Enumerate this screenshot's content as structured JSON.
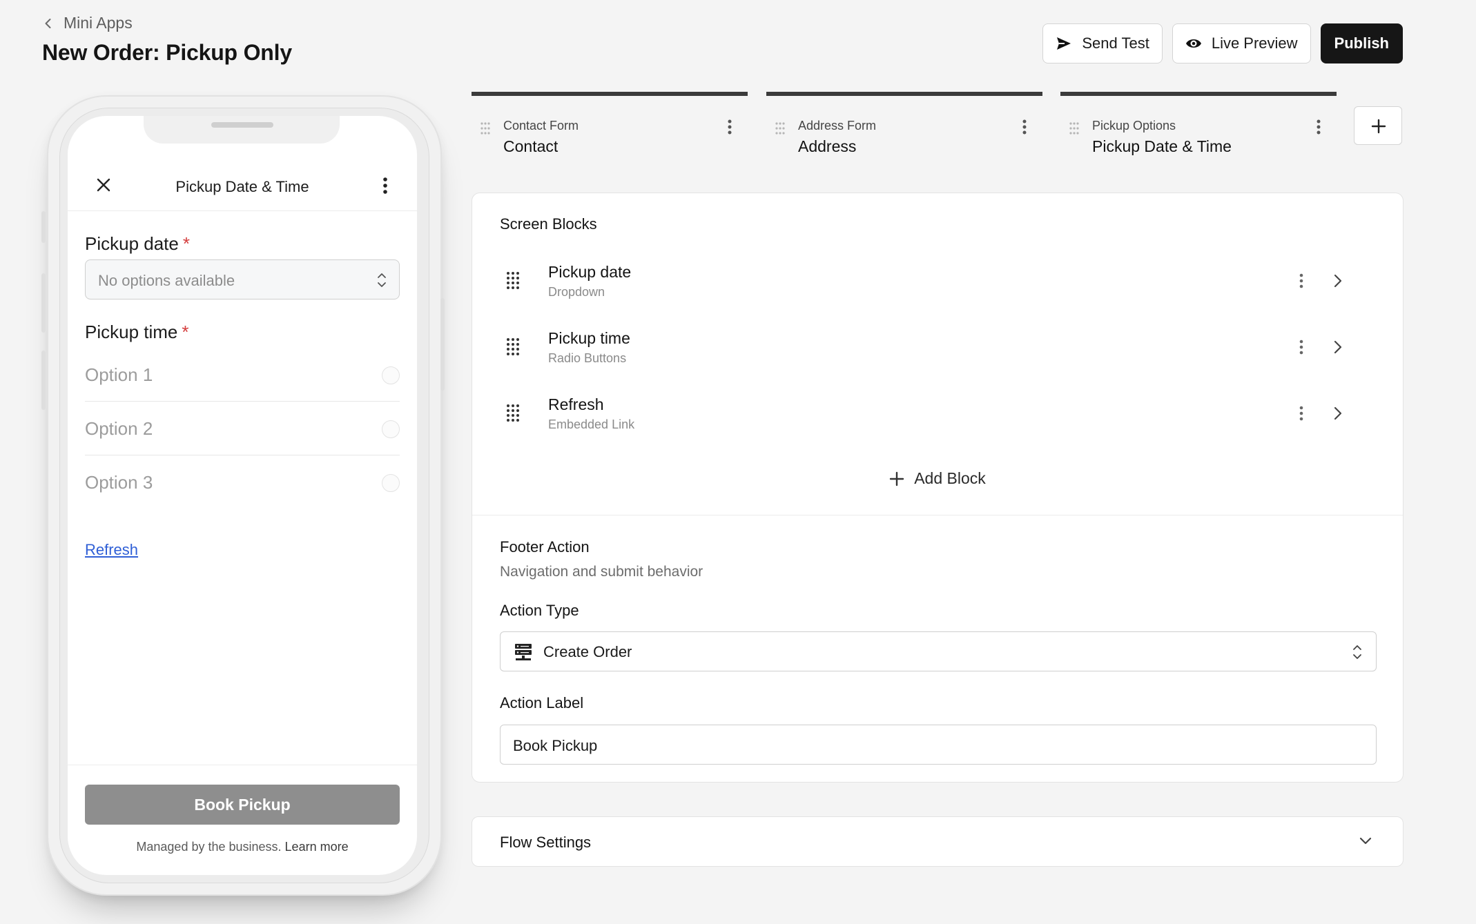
{
  "header": {
    "back_label": "Mini Apps",
    "title": "New Order: Pickup Only",
    "actions": {
      "send_test": "Send Test",
      "live_preview": "Live Preview",
      "publish": "Publish"
    }
  },
  "phone": {
    "screen_title": "Pickup Date & Time",
    "pickup_date_label": "Pickup date",
    "required_mark": "*",
    "pickup_date_placeholder": "No options available",
    "pickup_time_label": "Pickup time",
    "options": [
      "Option 1",
      "Option 2",
      "Option 3"
    ],
    "refresh_link": "Refresh",
    "footer_button": "Book Pickup",
    "managed_text": "Managed by the business.",
    "learn_more": "Learn more"
  },
  "screens": [
    {
      "type": "Contact Form",
      "name": "Contact"
    },
    {
      "type": "Address Form",
      "name": "Address"
    },
    {
      "type": "Pickup Options",
      "name": "Pickup Date & Time"
    }
  ],
  "editor": {
    "blocks_title": "Screen Blocks",
    "blocks": [
      {
        "name": "Pickup date",
        "type": "Dropdown"
      },
      {
        "name": "Pickup time",
        "type": "Radio Buttons"
      },
      {
        "name": "Refresh",
        "type": "Embedded Link"
      }
    ],
    "add_block": "Add Block",
    "footer": {
      "title": "Footer Action",
      "subtitle": "Navigation and submit behavior",
      "action_type_label": "Action Type",
      "action_type_value": "Create Order",
      "action_label_label": "Action Label",
      "action_label_value": "Book Pickup"
    },
    "flow_settings": "Flow Settings"
  },
  "icons": {
    "back": "chevron-left-icon",
    "send": "send-icon",
    "preview": "eye-icon",
    "close": "close-icon",
    "kebab": "kebab-icon",
    "grip": "drag-handle-icon",
    "add": "plus-icon",
    "server": "server-icon",
    "chevron_right": "chevron-right-icon",
    "chevron_down": "chevron-down-icon",
    "updown": "chevron-updown-icon"
  },
  "colors": {
    "accent_dark": "#161616",
    "required": "#d43d3d",
    "link": "#2f5fd6",
    "disabled_button": "#8e8e8e"
  }
}
